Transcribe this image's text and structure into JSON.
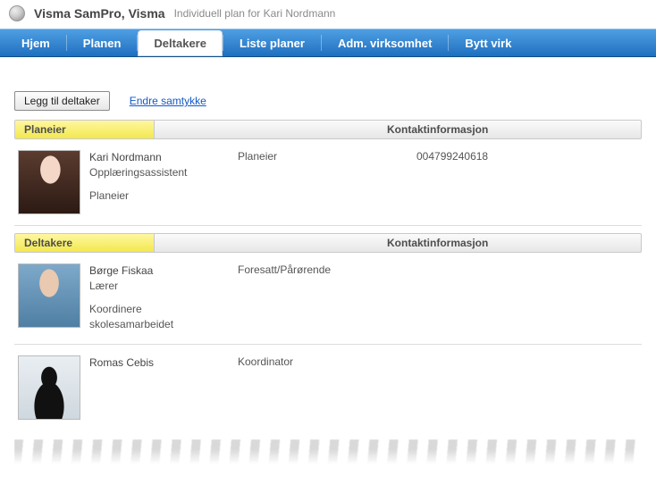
{
  "header": {
    "app_title": "Visma SamPro, Visma",
    "subtitle": "Individuell plan for Kari Nordmann"
  },
  "nav": {
    "items": [
      {
        "label": "Hjem",
        "active": false
      },
      {
        "label": "Planen",
        "active": false
      },
      {
        "label": "Deltakere",
        "active": true
      },
      {
        "label": "Liste planer",
        "active": false
      },
      {
        "label": "Adm. virksomhet",
        "active": false
      },
      {
        "label": "Bytt virk",
        "active": false
      }
    ]
  },
  "toolbar": {
    "add_button": "Legg til deltaker",
    "consent_link": "Endre samtykke"
  },
  "sections": {
    "owner": {
      "title": "Planeier",
      "contact_label": "Kontaktinformasjon"
    },
    "participants": {
      "title": "Deltakere",
      "contact_label": "Kontaktinformasjon"
    }
  },
  "owner_row": {
    "name": "Kari Nordmann",
    "title": "Opplæringsassistent",
    "note": "Planeier",
    "role": "Planeier",
    "contact": "004799240618"
  },
  "participants": [
    {
      "name": "Børge Fiskaa",
      "title": "Lærer",
      "note": "Koordinere skolesamarbeidet",
      "role": "Foresatt/Pårørende",
      "contact": ""
    },
    {
      "name": "Romas Cebis",
      "title": "",
      "note": "",
      "role": "Koordinator",
      "contact": ""
    }
  ]
}
